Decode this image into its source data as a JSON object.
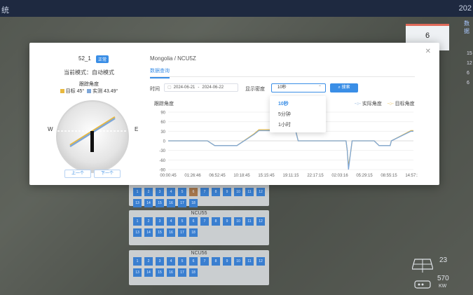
{
  "window": {
    "title_fragment": "统",
    "clock_fragment": "202"
  },
  "background": {
    "panels": [
      {
        "title": "",
        "cells": [
          "1",
          "2",
          "3",
          "4",
          "5",
          "6",
          "7",
          "8",
          "9",
          "10",
          "11",
          "12",
          "13",
          "14",
          "15",
          "16",
          "17",
          "18"
        ],
        "brown": [
          "6"
        ]
      },
      {
        "title": "NCU55",
        "cells": [
          "1",
          "2",
          "3",
          "4",
          "5",
          "6",
          "7",
          "8",
          "9",
          "10",
          "11",
          "12",
          "13",
          "14",
          "15",
          "16",
          "17",
          "18"
        ],
        "brown": []
      },
      {
        "title": "NCU56",
        "cells": [
          "1",
          "2",
          "3",
          "4",
          "5",
          "6",
          "7",
          "8",
          "9",
          "10",
          "11",
          "12",
          "13",
          "14",
          "15",
          "16",
          "17",
          "18"
        ],
        "brown": []
      }
    ],
    "right_card": {
      "value": "6"
    },
    "right_link": "数据",
    "right_numbers": [
      "15",
      "12",
      "6",
      "6"
    ],
    "panel_icon_value": "23",
    "bottom_value": "570",
    "bottom_unit": "KW"
  },
  "modal": {
    "device": "52_1",
    "status": "正常",
    "mode": "当前模式：自动模式",
    "tracking_angle_title": "跟踪角度",
    "target_label": "目标 45°",
    "actual_label": "实测 43.49°",
    "west": "W",
    "east": "E",
    "prev": "上一个",
    "next": "下一个",
    "breadcrumb": "Mongolia / NCU5Z",
    "tab": "数据查询",
    "time_label": "时间",
    "date_start": "2024-06-21",
    "date_sep": "-",
    "date_end": "2024-06-22",
    "density_label": "显示密度",
    "density_value": "10秒",
    "density_options": [
      "10秒",
      "5分钟",
      "1小时"
    ],
    "search": "搜索",
    "y_title": "跟踪角度",
    "colors": {
      "accent": "#3a8ee6",
      "actual": "#7ea7d8",
      "target": "#e9b93f"
    }
  },
  "chart_data": {
    "type": "line",
    "ylabel": "跟踪角度",
    "ylim": [
      -90,
      90
    ],
    "y_ticks": [
      90,
      60,
      30,
      0,
      -30,
      -60,
      -90
    ],
    "x_ticks": [
      "00:00:45",
      "01:26:46",
      "06:52:45",
      "10:18:45",
      "15:15:45",
      "19:11:15",
      "22:17:15",
      "02:03:16",
      "05:29:15",
      "08:55:15",
      "14:57:16"
    ],
    "series": [
      {
        "name": "实际角度",
        "color": "#7ea7d8",
        "x": [
          0,
          0.8,
          1.6,
          1.9,
          2.8,
          3.5,
          3.7,
          4.5,
          5.2,
          5.3,
          5.9,
          7.25,
          7.3,
          7.35,
          7.45,
          7.5,
          7.6,
          8.4,
          8.6,
          9.05,
          9.1,
          9.9,
          10.0
        ],
        "values": [
          0,
          0,
          0,
          -15,
          -15,
          20,
          32,
          32,
          30,
          0,
          0,
          0,
          -28,
          -90,
          -28,
          0,
          0,
          0,
          -15,
          -15,
          0,
          30,
          30
        ]
      },
      {
        "name": "目标角度",
        "color": "#e9b93f",
        "x": [
          0,
          0.8,
          1.6,
          1.9,
          2.8,
          3.5,
          3.7,
          4.5,
          5.2,
          5.3,
          5.9,
          7.25,
          7.3,
          7.35,
          7.45,
          7.5,
          7.6,
          8.4,
          8.6,
          9.05,
          9.1,
          9.9,
          10.0
        ],
        "values": [
          0,
          0,
          0,
          -15,
          -15,
          22,
          35,
          35,
          32,
          0,
          0,
          0,
          -30,
          -80,
          -30,
          0,
          0,
          0,
          -15,
          -15,
          0,
          32,
          32
        ]
      }
    ]
  }
}
